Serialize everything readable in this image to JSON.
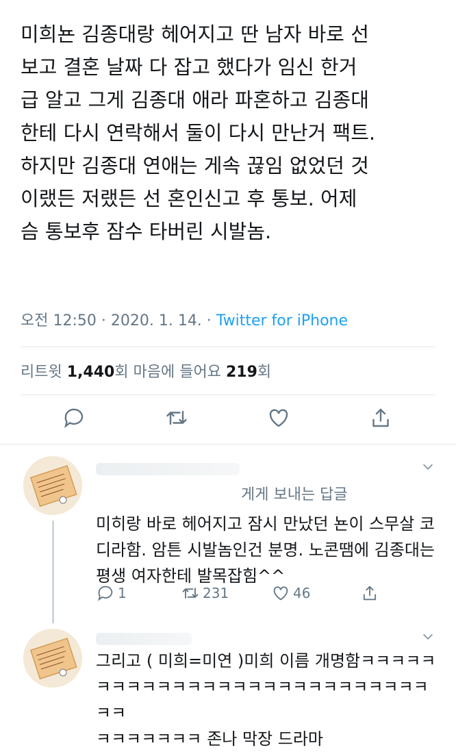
{
  "tweet": {
    "text": "미희뇬 김종대랑 헤어지고 딴 남자 바로 선\n보고 결혼 날짜 다 잡고 했다가 임신 한거\n급 알고 그게 김종대 애라 파혼하고 김종대\n한테 다시 연락해서 둘이 다시 만난거 팩트.\n하지만 김종대 연애는 게속 끊임 없었던 것\n이랬든 저랬든 선 혼인신고 후 통보. 어제\n슴 통보후 잠수 타버린 시발놈.",
    "time": "오전 12:50",
    "sep1": " · ",
    "date": "2020. 1. 14.",
    "sep2": " · ",
    "source": "Twitter for iPhone",
    "retweet_label": "리트윗 ",
    "retweet_count": "1,440",
    "retweet_unit": "회  ",
    "like_label": "마음에 들어요 ",
    "like_count": "219",
    "like_unit": "회"
  },
  "replies": [
    {
      "reply_to": "게게 보내는 답글",
      "text": "미히랑 바로 헤어지고 잠시 만났던 뇬이 스무살 코\n디라함. 암튼 시발놈인건 분명. 노콘땜에 김종대는\n평생 여자한테 발목잡힘^^",
      "reply_count": "1",
      "retweet_count": "231",
      "like_count": "46"
    },
    {
      "text": "그리고 ( 미희=미연 )미희 이름 개명함ㅋㅋㅋㅋㅋ\nㅋㅋㅋㅋㅋㅋㅋㅋㅋㅋㅋㅋㅋㅋㅋㅋㅋㅋㅋㅋㅋㅋㅋㅋ\nㅋㅋㅋㅋㅋㅋㅋ 존나 막장 드라마"
    }
  ],
  "colors": {
    "accent": "#1da1f2",
    "muted": "#657786",
    "text": "#14171a",
    "divider": "#e1e8ed"
  },
  "icons": [
    "reply-icon",
    "retweet-icon",
    "like-icon",
    "share-icon",
    "chevron-down-icon"
  ]
}
